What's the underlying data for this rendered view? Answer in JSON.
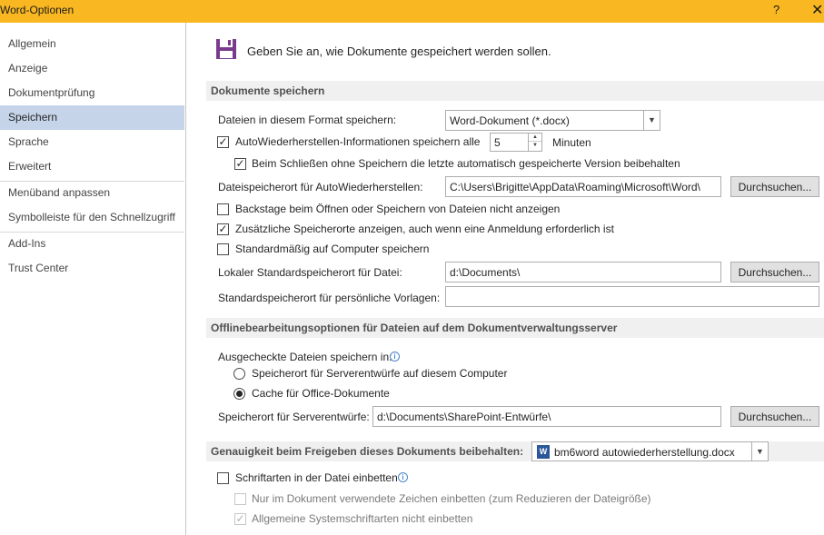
{
  "window": {
    "title": "Word-Optionen",
    "help_label": "?",
    "close_label": "✕"
  },
  "sidebar": {
    "items": [
      {
        "label": "Allgemein"
      },
      {
        "label": "Anzeige"
      },
      {
        "label": "Dokumentprüfung"
      },
      {
        "label": "Speichern",
        "active": true
      },
      {
        "label": "Sprache"
      },
      {
        "label": "Erweitert"
      },
      {
        "label": "Menüband anpassen"
      },
      {
        "label": "Symbolleiste für den Schnellzugriff"
      },
      {
        "label": "Add-Ins"
      },
      {
        "label": "Trust Center"
      }
    ]
  },
  "header": {
    "icon": "floppy-disk-icon",
    "text": "Geben Sie an, wie Dokumente gespeichert werden sollen."
  },
  "save_section": {
    "title": "Dokumente speichern",
    "format_label": "Dateien in diesem Format speichern:",
    "format_value": "Word-Dokument (*.docx)",
    "autorecover_label": "AutoWiederherstellen-Informationen speichern alle",
    "autorecover_checked": true,
    "autorecover_minutes": "5",
    "minutes_label": "Minuten",
    "keep_last_label": "Beim Schließen ohne Speichern die letzte automatisch gespeicherte Version beibehalten",
    "keep_last_checked": true,
    "autorecover_path_label": "Dateispeicherort für AutoWiederherstellen:",
    "autorecover_path_value": "C:\\Users\\Brigitte\\AppData\\Roaming\\Microsoft\\Word\\",
    "browse_label": "Durchsuchen...",
    "backstage_label": "Backstage beim Öffnen oder Speichern von Dateien nicht anzeigen",
    "backstage_checked": false,
    "additional_locations_label": "Zusätzliche Speicherorte anzeigen, auch wenn eine Anmeldung erforderlich ist",
    "additional_locations_checked": true,
    "default_computer_label": "Standardmäßig auf Computer speichern",
    "default_computer_checked": false,
    "local_default_label": "Lokaler Standardspeicherort für Datei:",
    "local_default_value": "d:\\Documents\\",
    "templates_label": "Standardspeicherort für persönliche Vorlagen:",
    "templates_value": ""
  },
  "offline_section": {
    "title": "Offlinebearbeitungsoptionen für Dateien auf dem Dokumentverwaltungsserver",
    "checkout_label": "Ausgecheckte Dateien speichern in:",
    "info_glyph": "i",
    "option_server_label": "Speicherort für Serverentwürfe auf diesem Computer",
    "option_cache_label": "Cache für Office-Dokumente",
    "selected_option": "cache",
    "server_drafts_label": "Speicherort für Serverentwürfe:",
    "server_drafts_value": "d:\\Documents\\SharePoint-Entwürfe\\"
  },
  "fidelity_section": {
    "title": "Genauigkeit beim Freigeben dieses Dokuments beibehalten:",
    "document_value": "bm6word autowiederherstellung.docx",
    "word_icon_glyph": "W",
    "embed_fonts_label": "Schriftarten in der Datei einbetten",
    "embed_fonts_checked": false,
    "only_used_chars_label": "Nur im Dokument verwendete Zeichen einbetten (zum Reduzieren der Dateigröße)",
    "only_used_chars_checked": false,
    "no_system_fonts_label": "Allgemeine Systemschriftarten nicht einbetten",
    "no_system_fonts_checked": true
  },
  "glyphs": {
    "check": "✓",
    "dropdown": "▼",
    "spin_up": "▲",
    "spin_down": "▼"
  }
}
